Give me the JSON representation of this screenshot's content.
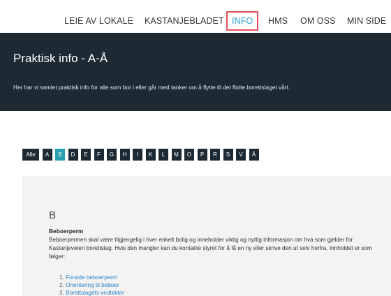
{
  "nav": {
    "items": [
      {
        "label": "LEIE AV LOKALE"
      },
      {
        "label": "KASTANJEBLADET"
      },
      {
        "label": "INFO",
        "active": true
      },
      {
        "label": "HMS"
      },
      {
        "label": "OM OSS"
      },
      {
        "label": "MIN SIDE"
      }
    ]
  },
  "hero": {
    "title": "Praktisk info - A-Å",
    "subtitle": "Her har vi samlet praktisk info for alle som bor i eller går med tanker om å flytte til det flotte borettslaget vårt."
  },
  "alphabet": [
    "Alle",
    "A",
    "B",
    "D",
    "E",
    "F",
    "G",
    "H",
    "I",
    "K",
    "L",
    "M",
    "O",
    "P",
    "R",
    "S",
    "V",
    "Å"
  ],
  "alphabet_selected": "B",
  "section": {
    "letter": "B",
    "entry_title": "Beboerperm",
    "entry_text": "Beboerpermen skal være tilgjengelig i hver enkelt bolig og inneholder viktig og nyttig informasjon om hva som gjelder for Kastanjeveien borettslag. Hvis den mangler kan du kontakte styret for å få en ny eller skrive den ut selv herfra. Innholdet er som følger:",
    "list": [
      {
        "num": "1.",
        "label": "Forside beboerperm"
      },
      {
        "num": "2.",
        "label": "Orientering til beboer"
      },
      {
        "num": "3.",
        "label": "Borettslagets vedtekter"
      }
    ]
  },
  "colors": {
    "dark": "#1d2a33",
    "accent": "#2a9fd6",
    "highlight_border": "#e0505a",
    "selected_letter": "#2a9fb0"
  }
}
